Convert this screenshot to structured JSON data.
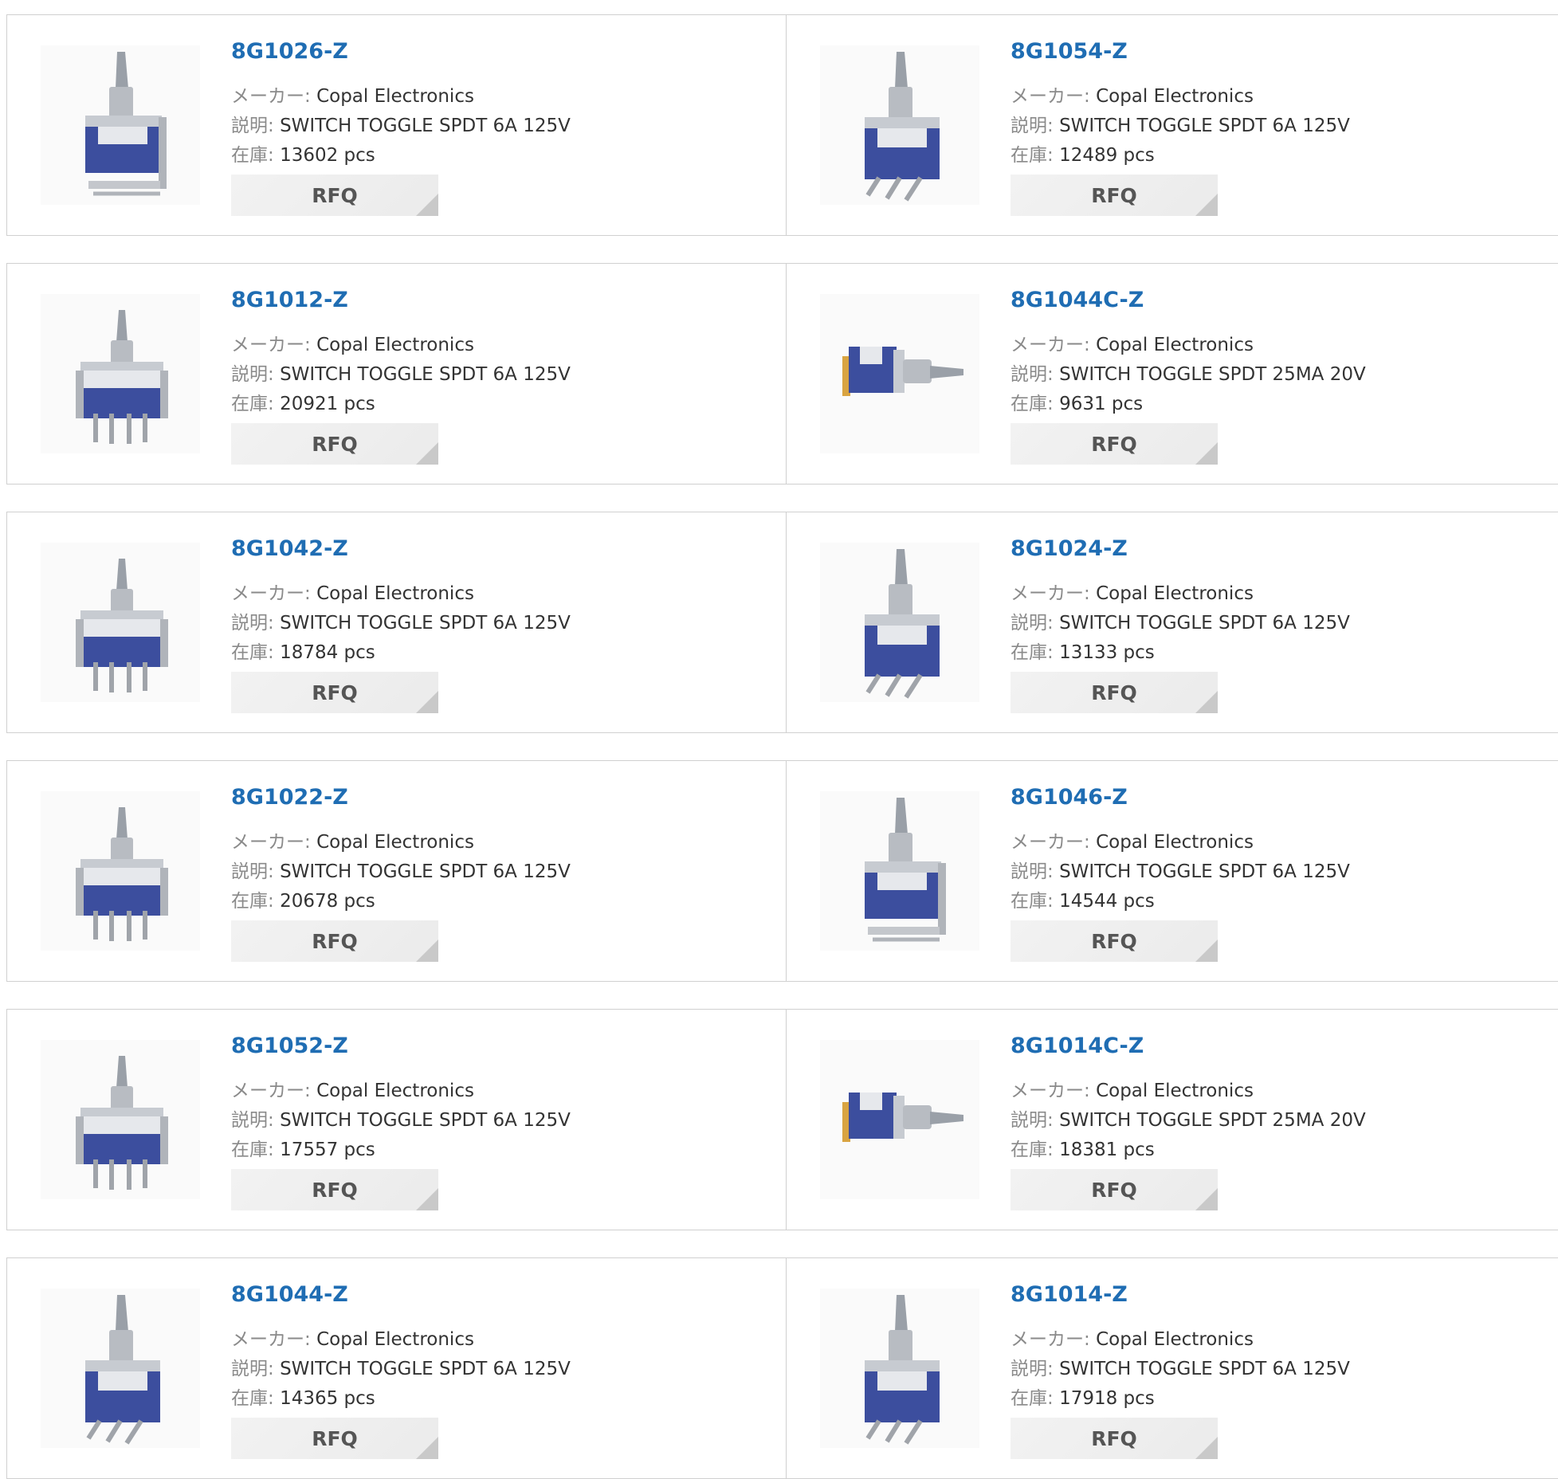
{
  "labels": {
    "maker": "メーカー:",
    "description": "説明:",
    "stock": "在庫:",
    "rfq": "RFQ"
  },
  "products": [
    {
      "part": "8G1026-Z",
      "maker": "Copal Electronics",
      "description": "SWITCH TOGGLE SPDT 6A 125V",
      "stock": "13602 pcs",
      "image": "toggle-switch-right-angle-long-leads"
    },
    {
      "part": "8G1054-Z",
      "maker": "Copal Electronics",
      "description": "SWITCH TOGGLE SPDT 6A 125V",
      "stock": "12489 pcs",
      "image": "toggle-switch-bent-leads"
    },
    {
      "part": "8G1012-Z",
      "maker": "Copal Electronics",
      "description": "SWITCH TOGGLE SPDT 6A 125V",
      "stock": "20921 pcs",
      "image": "toggle-switch-vertical-pins"
    },
    {
      "part": "8G1044C-Z",
      "maker": "Copal Electronics",
      "description": "SWITCH TOGGLE SPDT 25MA 20V",
      "stock": "9631 pcs",
      "image": "toggle-switch-horizontal"
    },
    {
      "part": "8G1042-Z",
      "maker": "Copal Electronics",
      "description": "SWITCH TOGGLE SPDT 6A 125V",
      "stock": "18784 pcs",
      "image": "toggle-switch-vertical-pins"
    },
    {
      "part": "8G1024-Z",
      "maker": "Copal Electronics",
      "description": "SWITCH TOGGLE SPDT 6A 125V",
      "stock": "13133 pcs",
      "image": "toggle-switch-bent-leads"
    },
    {
      "part": "8G1022-Z",
      "maker": "Copal Electronics",
      "description": "SWITCH TOGGLE SPDT 6A 125V",
      "stock": "20678 pcs",
      "image": "toggle-switch-vertical-pins"
    },
    {
      "part": "8G1046-Z",
      "maker": "Copal Electronics",
      "description": "SWITCH TOGGLE SPDT 6A 125V",
      "stock": "14544 pcs",
      "image": "toggle-switch-right-angle-long-leads"
    },
    {
      "part": "8G1052-Z",
      "maker": "Copal Electronics",
      "description": "SWITCH TOGGLE SPDT 6A 125V",
      "stock": "17557 pcs",
      "image": "toggle-switch-vertical-pins"
    },
    {
      "part": "8G1014C-Z",
      "maker": "Copal Electronics",
      "description": "SWITCH TOGGLE SPDT 25MA 20V",
      "stock": "18381 pcs",
      "image": "toggle-switch-horizontal"
    },
    {
      "part": "8G1044-Z",
      "maker": "Copal Electronics",
      "description": "SWITCH TOGGLE SPDT 6A 125V",
      "stock": "14365 pcs",
      "image": "toggle-switch-bent-leads"
    },
    {
      "part": "8G1014-Z",
      "maker": "Copal Electronics",
      "description": "SWITCH TOGGLE SPDT 6A 125V",
      "stock": "17918 pcs",
      "image": "toggle-switch-bent-leads"
    }
  ]
}
